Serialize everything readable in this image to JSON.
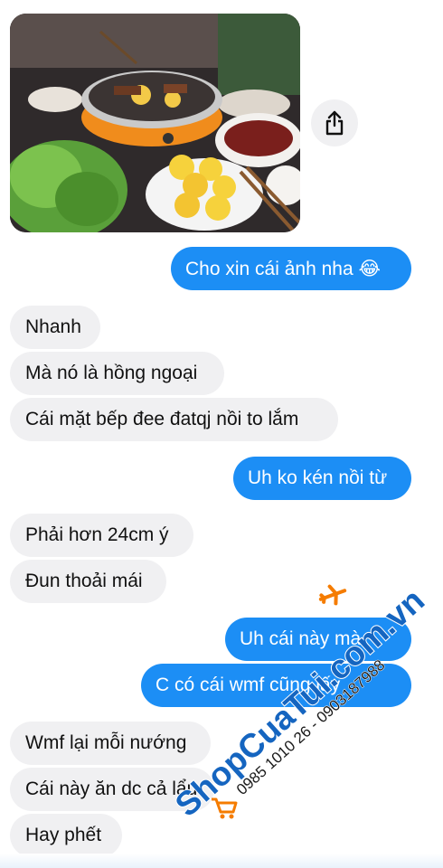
{
  "messages": [
    {
      "text": "Cho xin cái ảnh nha 😂",
      "from": "me"
    },
    {
      "text": "Nhanh",
      "from": "other"
    },
    {
      "text": "Mà nó là hồng ngoại",
      "from": "other"
    },
    {
      "text": "Cái mặt bếp đee đatqj nồi to lắm",
      "from": "other"
    },
    {
      "text": "Uh ko kén nồi từ",
      "from": "me"
    },
    {
      "text": "Phải hơn 24cm ý",
      "from": "other"
    },
    {
      "text": "Đun thoải mái",
      "from": "other"
    },
    {
      "text": "Uh cái này   mà",
      "from": "me"
    },
    {
      "text": "C có cái wmf       cũng lấy",
      "from": "me"
    },
    {
      "text": "Wmf lại mỗi nướng",
      "from": "other"
    },
    {
      "text": "Cái này ăn dc cả lẩu",
      "from": "other"
    },
    {
      "text": "Hay phết",
      "from": "other"
    }
  ],
  "watermark": {
    "brand": "ShopCuaTui.com.vn",
    "phones": "0985 1010 26 - 0903187988"
  },
  "colors": {
    "outgoing_bubble": "#1c8ef5",
    "incoming_bubble": "#f0f0f2",
    "watermark_blue": "#1565c0",
    "watermark_orange": "#f57c00"
  },
  "icons": [
    "share-icon",
    "airplane-icon",
    "shopping-cart-icon"
  ]
}
